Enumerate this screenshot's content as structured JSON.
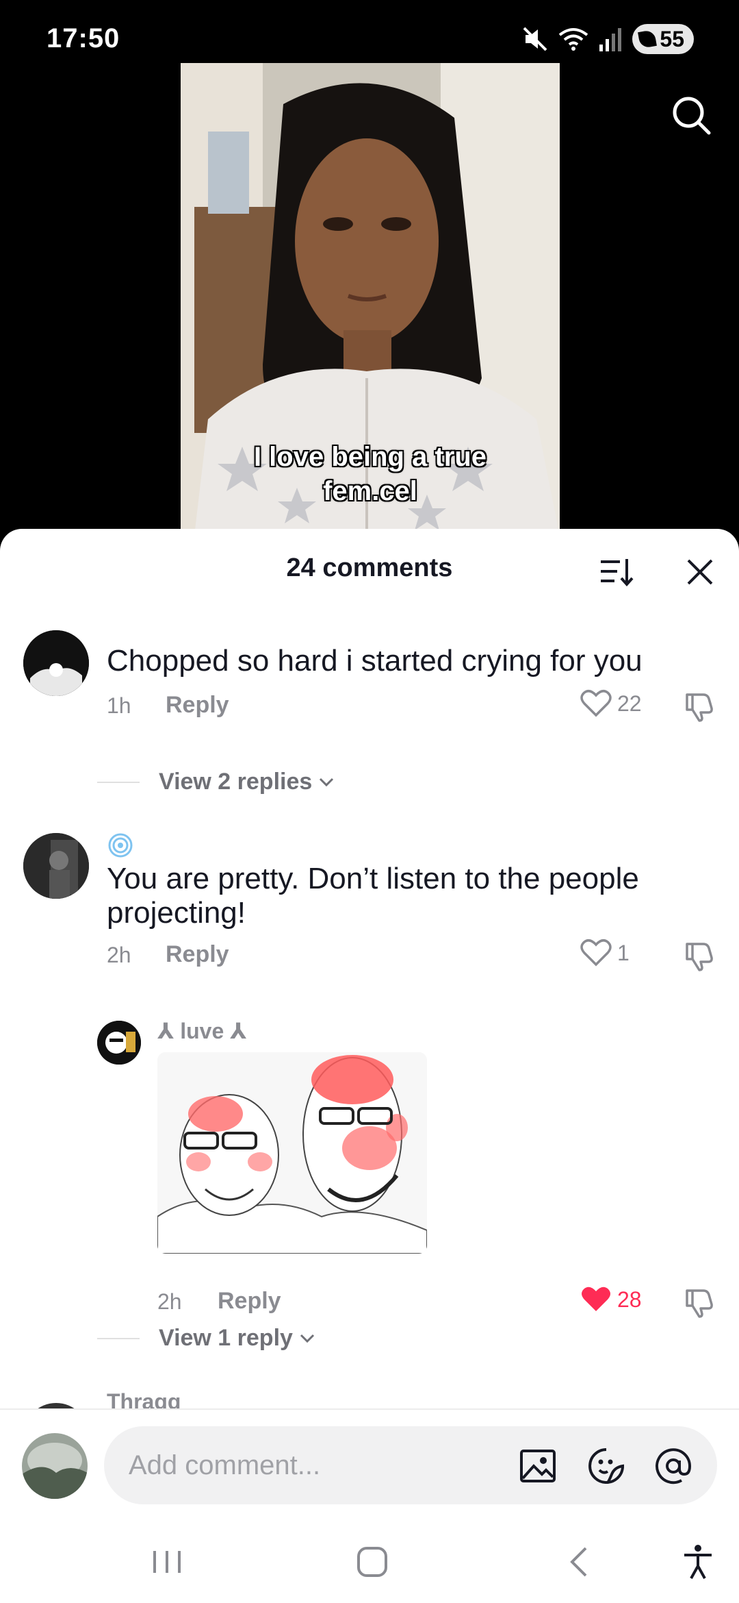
{
  "status_bar": {
    "time": "17:50",
    "battery": "55"
  },
  "video": {
    "caption_line1": "I love being a true",
    "caption_line2": "fem.cel"
  },
  "comments_header": {
    "title": "24 comments"
  },
  "comments": [
    {
      "text": "Chopped so hard i started crying for you",
      "time": "1h",
      "reply_label": "Reply",
      "likes": "22",
      "view_replies": "View 2 replies"
    },
    {
      "text": "You are pretty. Don’t listen to the people projecting!",
      "time": "2h",
      "reply_label": "Reply",
      "likes": "1"
    }
  ],
  "reply": {
    "username": "⅄ luve ⅄",
    "time": "2h",
    "reply_label": "Reply",
    "likes": "28",
    "liked": true,
    "view_replies": "View 1 reply"
  },
  "partial_comment": {
    "username": "Thragg"
  },
  "input": {
    "placeholder": "Add comment..."
  },
  "colors": {
    "like_red": "#fe2c55",
    "text": "#161823",
    "muted": "#8a8b91"
  }
}
